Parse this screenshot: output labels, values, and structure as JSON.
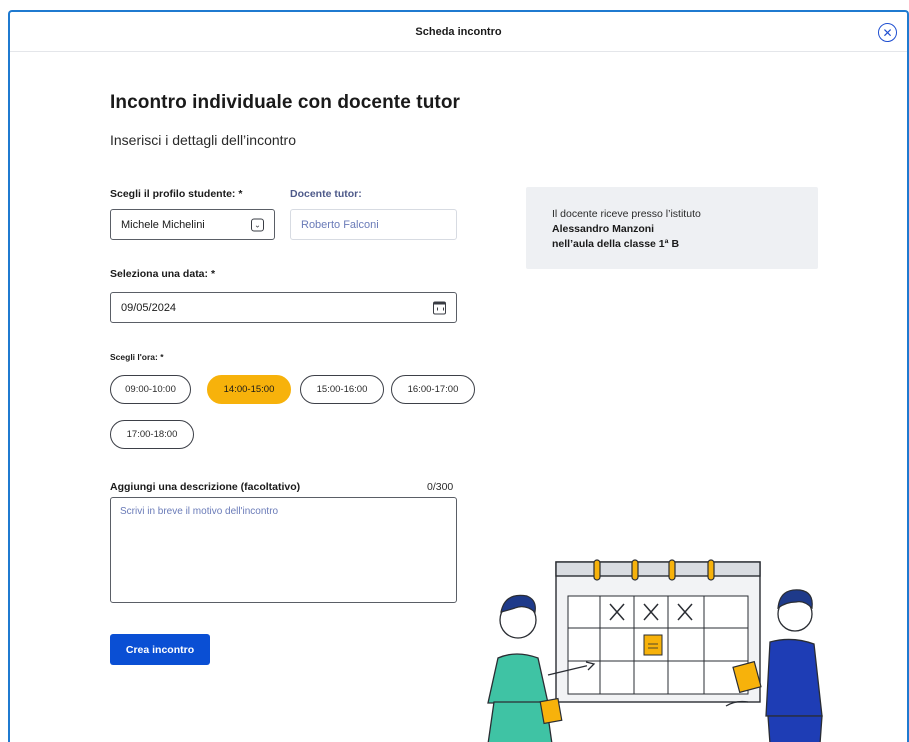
{
  "header": {
    "title": "Scheda incontro"
  },
  "page": {
    "title": "Incontro individuale con docente tutor",
    "subtitle": "Inserisci i dettagli dell’incontro"
  },
  "form": {
    "student_label": "Scegli il profilo studente: *",
    "student_value": "Michele Michelini",
    "tutor_label": "Docente tutor:",
    "tutor_value": "Roberto Falconi",
    "date_label": "Seleziona una data: *",
    "date_value": "09/05/2024",
    "time_label": "Scegli l'ora: *",
    "time_slots": [
      {
        "label": "09:00-10:00",
        "selected": false
      },
      {
        "label": "14:00-15:00",
        "selected": true
      },
      {
        "label": "15:00-16:00",
        "selected": false
      },
      {
        "label": "16:00-17:00",
        "selected": false
      },
      {
        "label": "17:00-18:00",
        "selected": false
      }
    ],
    "description_label": "Aggiungi una descrizione (facoltativo)",
    "description_counter": "0/300",
    "description_placeholder": "Scrivi in breve il motivo dell'incontro",
    "submit_label": "Crea incontro"
  },
  "info": {
    "line1": "Il docente riceve presso l’istituto",
    "line2": "Alessandro Manzoni",
    "line3": "nell’aula della classe 1ª B"
  },
  "icons": {
    "close": "close-icon",
    "select": "chevron-down-icon",
    "date": "calendar-icon"
  },
  "colors": {
    "accent": "#0a4fd4",
    "selected_slot": "#f7b20b",
    "frame": "#1f7ad0",
    "info_bg": "#eef0f3"
  }
}
